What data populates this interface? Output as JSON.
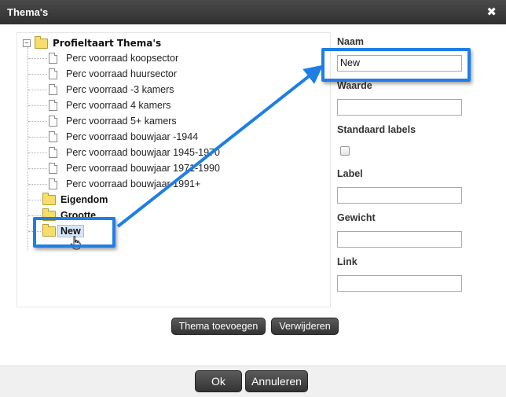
{
  "window": {
    "title": "Thema's",
    "close_icon": "close-icon"
  },
  "tree": {
    "root_label": "Profieltaart Thema's",
    "expander_symbol": "−",
    "items": [
      {
        "label": "Perc voorraad koopsector",
        "type": "file"
      },
      {
        "label": "Perc voorraad huursector",
        "type": "file"
      },
      {
        "label": "Perc voorraad -3 kamers",
        "type": "file"
      },
      {
        "label": "Perc voorraad 4 kamers",
        "type": "file"
      },
      {
        "label": "Perc voorraad 5+ kamers",
        "type": "file"
      },
      {
        "label": "Perc voorraad bouwjaar -1944",
        "type": "file"
      },
      {
        "label": "Perc voorraad bouwjaar 1945-1970",
        "type": "file"
      },
      {
        "label": "Perc voorraad bouwjaar 1971-1990",
        "type": "file"
      },
      {
        "label": "Perc voorraad bouwjaar 1991+",
        "type": "file"
      },
      {
        "label": "Eigendom",
        "type": "folder"
      },
      {
        "label": "Grootte",
        "type": "folder"
      },
      {
        "label": "New",
        "type": "folder",
        "selected": true
      }
    ]
  },
  "form": {
    "naam_label": "Naam",
    "naam_value": "New",
    "waarde_label": "Waarde",
    "waarde_value": "",
    "standaard_labels_label": "Standaard labels",
    "standaard_labels_checked": false,
    "label_label": "Label",
    "label_value": "",
    "gewicht_label": "Gewicht",
    "gewicht_value": "",
    "link_label": "Link",
    "link_value": ""
  },
  "actions": {
    "add_theme_label": "Thema toevoegen",
    "delete_label": "Verwijderen"
  },
  "footer": {
    "ok_label": "Ok",
    "cancel_label": "Annuleren"
  },
  "colors": {
    "highlight": "#1e7ee6",
    "titlebar": "#3a3a3a",
    "selection": "#d7e7f8"
  }
}
